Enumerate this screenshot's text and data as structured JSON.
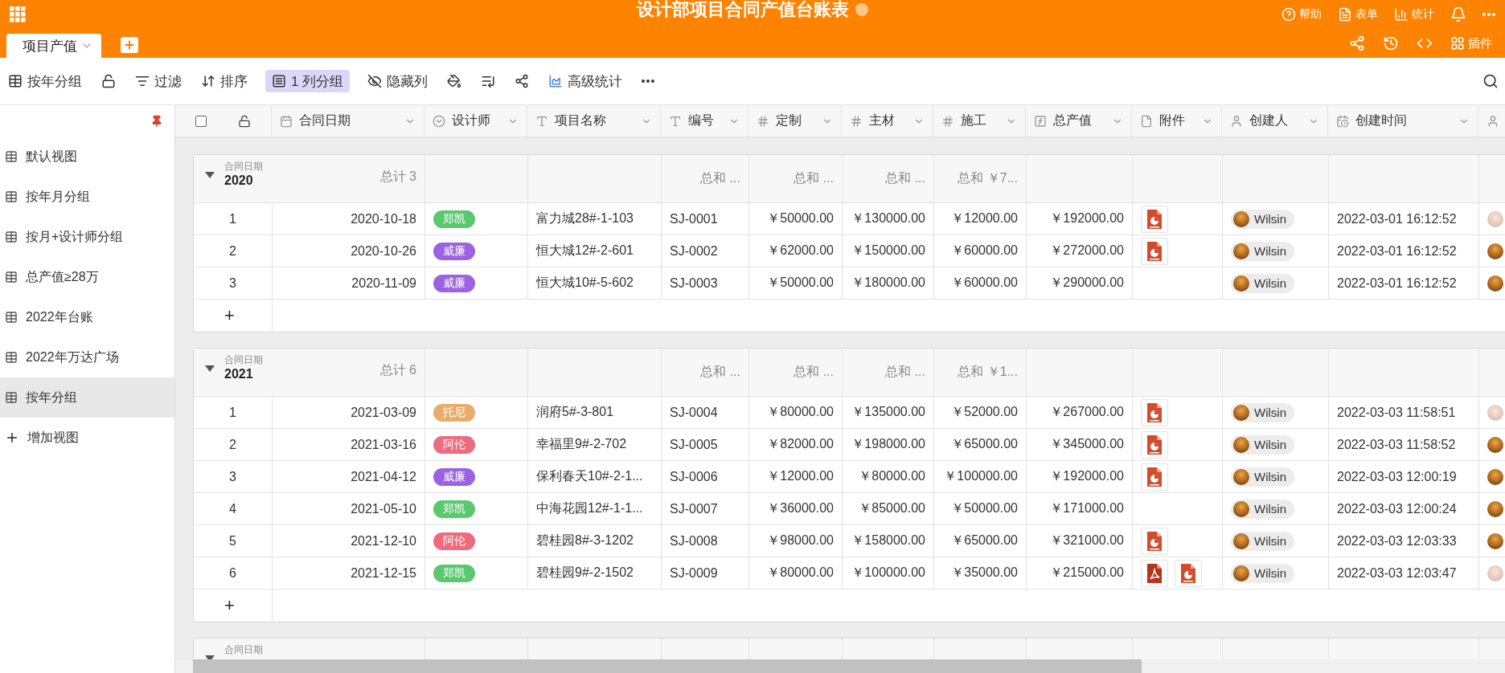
{
  "app_bar": {
    "title": "设计部项目合同产值台账表",
    "actions": [
      {
        "label": "帮助"
      },
      {
        "label": "表单"
      },
      {
        "label": "统计"
      }
    ]
  },
  "tab_bar": {
    "tabs": [
      {
        "label": "项目产值",
        "selected": true
      }
    ],
    "plugin_label": "插件"
  },
  "toolbar": [
    {
      "label": "按年分组",
      "selected": false
    },
    {
      "selected": false
    },
    {
      "label": "过滤",
      "selected": false
    },
    {
      "label": "排序",
      "selected": false
    },
    {
      "label": "1 列分组",
      "selected": true
    },
    {
      "label": "隐藏列",
      "selected": false
    },
    {
      "selected": false
    },
    {
      "selected": false
    },
    {
      "selected": false
    },
    {
      "label": "高级统计",
      "selected": false
    },
    {
      "selected": false
    }
  ],
  "sidebar": {
    "items": [
      {
        "label": "默认视图",
        "selected": false
      },
      {
        "label": "按年月分组",
        "selected": false
      },
      {
        "label": "按月+设计师分组",
        "selected": false
      },
      {
        "label": "总产值≥28万",
        "selected": false
      },
      {
        "label": "2022年台账",
        "selected": false
      },
      {
        "label": "2022年万达广场",
        "selected": false
      },
      {
        "label": "按年分组",
        "selected": true
      }
    ],
    "add_label": "增加视图"
  },
  "table": {
    "select_all": {
      "checked": false
    },
    "columns": [
      {
        "kind": "date",
        "label": "合同日期"
      },
      {
        "kind": "select",
        "label": "设计师"
      },
      {
        "kind": "text",
        "label": "项目名称"
      },
      {
        "kind": "text",
        "label": "编号"
      },
      {
        "kind": "number",
        "label": "定制"
      },
      {
        "kind": "number",
        "label": "主材"
      },
      {
        "kind": "number",
        "label": "施工"
      },
      {
        "kind": "formula",
        "label": "总产值"
      },
      {
        "kind": "file",
        "label": "附件"
      },
      {
        "kind": "user",
        "label": "创建人"
      },
      {
        "kind": "ctime",
        "label": "创建时间"
      },
      {
        "kind": "user"
      }
    ],
    "groups": [
      {
        "expanded": true,
        "field_label": "合同日期",
        "year": "2020",
        "total": "总计 3",
        "sums": [
          {
            "label": "总和",
            "value": "..."
          },
          {
            "label": "总和",
            "value": "..."
          },
          {
            "label": "总和",
            "value": "..."
          },
          {
            "label": "总和",
            "value": "￥7..."
          }
        ],
        "add_label": "+",
        "rows": [
          {
            "no": "1",
            "date": "2020-10-18",
            "designer": {
              "name": "郑凯",
              "color": "#5ac86e"
            },
            "project": "富力城28#-1-103",
            "code": "SJ-0001",
            "custom": "￥50000.00",
            "material": "￥130000.00",
            "construction": "￥12000.00",
            "total": "￥192000.00",
            "attachments": [
              {
                "kind": "ppt"
              }
            ],
            "creator": "Wilsin",
            "created": "2022-03-01 16:12:52",
            "extra_avatar": {
              "kind": "light"
            }
          },
          {
            "no": "2",
            "date": "2020-10-26",
            "designer": {
              "name": "威廉",
              "color": "#9b63e3"
            },
            "project": "恒大城12#-2-601",
            "code": "SJ-0002",
            "custom": "￥62000.00",
            "material": "￥150000.00",
            "construction": "￥60000.00",
            "total": "￥272000.00",
            "attachments": [
              {
                "kind": "ppt"
              }
            ],
            "creator": "Wilsin",
            "created": "2022-03-01 16:12:52",
            "extra_avatar": {
              "kind": "dark"
            }
          },
          {
            "no": "3",
            "date": "2020-11-09",
            "designer": {
              "name": "威廉",
              "color": "#9b63e3"
            },
            "project": "恒大城10#-5-602",
            "code": "SJ-0003",
            "custom": "￥50000.00",
            "material": "￥180000.00",
            "construction": "￥60000.00",
            "total": "￥290000.00",
            "creator": "Wilsin",
            "created": "2022-03-01 16:12:52",
            "extra_avatar": {
              "kind": "dark"
            }
          }
        ]
      },
      {
        "expanded": true,
        "field_label": "合同日期",
        "year": "2021",
        "total": "总计 6",
        "sums": [
          {
            "label": "总和",
            "value": "..."
          },
          {
            "label": "总和",
            "value": "..."
          },
          {
            "label": "总和",
            "value": "..."
          },
          {
            "label": "总和",
            "value": "￥1..."
          }
        ],
        "add_label": "+",
        "rows": [
          {
            "no": "1",
            "date": "2021-03-09",
            "designer": {
              "name": "托尼",
              "color": "#e9ad6b"
            },
            "project": "润府5#-3-801",
            "code": "SJ-0004",
            "custom": "￥80000.00",
            "material": "￥135000.00",
            "construction": "￥52000.00",
            "total": "￥267000.00",
            "attachments": [
              {
                "kind": "ppt"
              }
            ],
            "creator": "Wilsin",
            "created": "2022-03-03 11:58:51",
            "extra_avatar": {
              "kind": "light"
            }
          },
          {
            "no": "2",
            "date": "2021-03-16",
            "designer": {
              "name": "阿伦",
              "color": "#f06a7e"
            },
            "project": "幸福里9#-2-702",
            "code": "SJ-0005",
            "custom": "￥82000.00",
            "material": "￥198000.00",
            "construction": "￥65000.00",
            "total": "￥345000.00",
            "attachments": [
              {
                "kind": "ppt"
              }
            ],
            "creator": "Wilsin",
            "created": "2022-03-03 11:58:52",
            "extra_avatar": {
              "kind": "dark"
            }
          },
          {
            "no": "3",
            "date": "2021-04-12",
            "designer": {
              "name": "威廉",
              "color": "#9b63e3"
            },
            "project": "保利春天10#-2-1...",
            "code": "SJ-0006",
            "custom": "￥12000.00",
            "material": "￥80000.00",
            "construction": "￥100000.00",
            "total": "￥192000.00",
            "attachments": [
              {
                "kind": "ppt"
              }
            ],
            "creator": "Wilsin",
            "created": "2022-03-03 12:00:19",
            "extra_avatar": {
              "kind": "dark"
            }
          },
          {
            "no": "4",
            "date": "2021-05-10",
            "designer": {
              "name": "郑凯",
              "color": "#5ac86e"
            },
            "project": "中海花园12#-1-1...",
            "code": "SJ-0007",
            "custom": "￥36000.00",
            "material": "￥85000.00",
            "construction": "￥50000.00",
            "total": "￥171000.00",
            "creator": "Wilsin",
            "created": "2022-03-03 12:00:24",
            "extra_avatar": {
              "kind": "dark"
            }
          },
          {
            "no": "5",
            "date": "2021-12-10",
            "designer": {
              "name": "阿伦",
              "color": "#f06a7e"
            },
            "project": "碧桂园8#-3-1202",
            "code": "SJ-0008",
            "custom": "￥98000.00",
            "material": "￥158000.00",
            "construction": "￥65000.00",
            "total": "￥321000.00",
            "attachments": [
              {
                "kind": "ppt"
              }
            ],
            "creator": "Wilsin",
            "created": "2022-03-03 12:03:33",
            "extra_avatar": {
              "kind": "dark"
            }
          },
          {
            "no": "6",
            "date": "2021-12-15",
            "designer": {
              "name": "郑凯",
              "color": "#5ac86e"
            },
            "project": "碧桂园9#-2-1502",
            "code": "SJ-0009",
            "custom": "￥80000.00",
            "material": "￥100000.00",
            "construction": "￥35000.00",
            "total": "￥215000.00",
            "attachments": [
              {
                "kind": "pdf"
              },
              {
                "kind": "ppt"
              }
            ],
            "creator": "Wilsin",
            "created": "2022-03-03 12:03:47",
            "extra_avatar": {
              "kind": "light"
            }
          }
        ]
      },
      {
        "expanded": true,
        "field_label": "合同日期"
      }
    ]
  }
}
